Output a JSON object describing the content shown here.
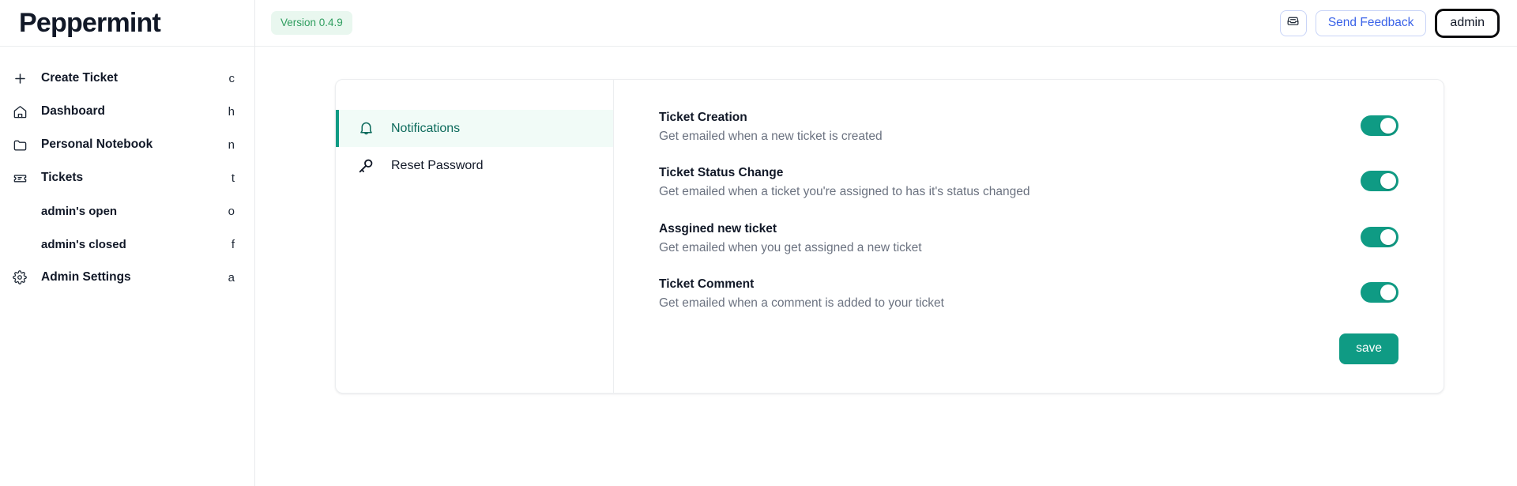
{
  "brand": {
    "title": "Peppermint"
  },
  "sidebar": {
    "items": [
      {
        "label": "Create Ticket",
        "key": "c",
        "icon": "plus-icon",
        "name": "create-ticket"
      },
      {
        "label": "Dashboard",
        "key": "h",
        "icon": "home-icon",
        "name": "dashboard"
      },
      {
        "label": "Personal Notebook",
        "key": "n",
        "icon": "folder-icon",
        "name": "personal-notebook"
      },
      {
        "label": "Tickets",
        "key": "t",
        "icon": "ticket-icon",
        "name": "tickets"
      }
    ],
    "subitems": [
      {
        "label": "admin's open",
        "key": "o",
        "name": "admins-open"
      },
      {
        "label": "admin's closed",
        "key": "f",
        "name": "admins-closed"
      }
    ],
    "footer_items": [
      {
        "label": "Admin Settings",
        "key": "a",
        "icon": "gear-icon",
        "name": "admin-settings"
      }
    ]
  },
  "topbar": {
    "version_badge": "Version 0.4.9",
    "inbox_icon": "inbox-icon",
    "feedback_label": "Send Feedback",
    "user_label": "admin"
  },
  "settings": {
    "tabs": [
      {
        "label": "Notifications",
        "icon": "bell-icon",
        "active": true,
        "name": "tab-notifications"
      },
      {
        "label": "Reset Password",
        "icon": "key-icon",
        "active": false,
        "name": "tab-reset-password"
      }
    ],
    "preferences": [
      {
        "title": "Ticket Creation",
        "description": "Get emailed when a new ticket is created",
        "enabled": true,
        "name": "ticket-creation"
      },
      {
        "title": "Ticket Status Change",
        "description": "Get emailed when a ticket you're assigned to has it's status changed",
        "enabled": true,
        "name": "ticket-status-change"
      },
      {
        "title": "Assgined new ticket",
        "description": "Get emailed when you get assigned a new ticket",
        "enabled": true,
        "name": "assigned-new-ticket"
      },
      {
        "title": "Ticket Comment",
        "description": "Get emailed when a comment is added to your ticket",
        "enabled": true,
        "name": "ticket-comment"
      }
    ],
    "save_label": "save"
  },
  "colors": {
    "accent_teal": "#0f9b84",
    "accent_teal_dark": "#0d6b5c",
    "tab_active_bg": "#f1fbf7",
    "version_badge_bg": "#e9f7ef",
    "version_badge_text": "#2f9e5f",
    "link_blue": "#3b63e8",
    "text_dark": "#111827",
    "text_muted": "#6b7280"
  }
}
